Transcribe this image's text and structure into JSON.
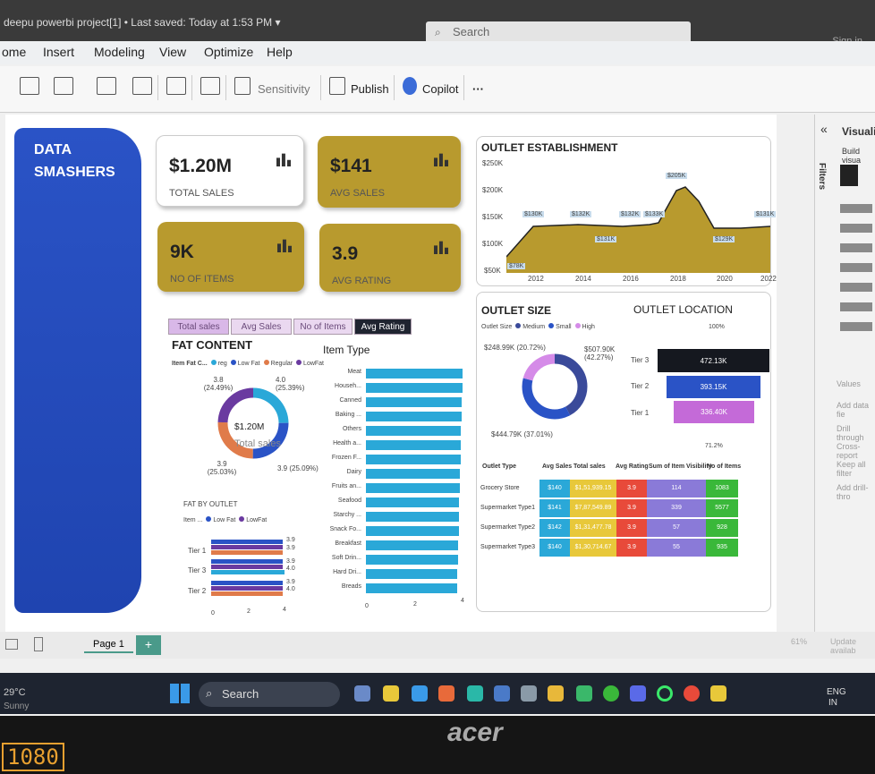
{
  "window": {
    "title": "deepu powerbi project[1] • Last saved: Today at 1:53 PM ▾",
    "search": "Search",
    "signin": "Sign in"
  },
  "menu": [
    "ome",
    "Insert",
    "Modeling",
    "View",
    "Optimize",
    "Help"
  ],
  "ribbon": {
    "sensitivity": "Sensitivity",
    "publish": "Publish",
    "copilot": "Copilot",
    "more": "···"
  },
  "sidebar": {
    "title": "DATA SMASHERS"
  },
  "kpis": [
    {
      "value": "$1.20M",
      "label": "TOTAL SALES"
    },
    {
      "value": "$141",
      "label": "AVG SALES"
    },
    {
      "value": "9K",
      "label": "NO OF ITEMS"
    },
    {
      "value": "3.9",
      "label": "AVG RATING"
    }
  ],
  "tabs": [
    "Total sales",
    "Avg Sales",
    "No of Items",
    "Avg Rating"
  ],
  "fat_content": {
    "title": "FAT CONTENT",
    "legend_title": "Item Fat C...",
    "legend": [
      "reg",
      "Low Fat",
      "Regular",
      "LowFat"
    ],
    "center_value": "$1.20M",
    "center_label": "Total sales",
    "labels": [
      "3.8\n(24.49%)",
      "4.0\n(25.39%)",
      "3.9\n(25.03%)",
      "3.9 (25.09%)"
    ]
  },
  "fat_by_outlet": {
    "title": "FAT BY OUTLET",
    "legend_title": "Item ...",
    "legend": [
      "Low Fat",
      "LowFat"
    ],
    "tiers": [
      "Tier 1",
      "Tier 3",
      "Tier 2"
    ],
    "values": [
      "3.9",
      "3.9",
      "3.9",
      "4.0",
      "3.9",
      "4.0"
    ],
    "axis": [
      "0",
      "2",
      "4"
    ]
  },
  "item_type": {
    "title": "Item Type",
    "labels": [
      "Meat",
      "Househ...",
      "Canned",
      "Baking ...",
      "Others",
      "Health a...",
      "Frozen F...",
      "Dairy",
      "Fruits an...",
      "Seafood",
      "Starchy ...",
      "Snack Fo...",
      "Breakfast",
      "Soft Drin...",
      "Hard Dri...",
      "Breads"
    ],
    "axis": [
      "0",
      "2",
      "4"
    ]
  },
  "outlet_establishment": {
    "title": "OUTLET ESTABLISHMENT",
    "y_ticks": [
      "$250K",
      "$200K",
      "$150K",
      "$100K",
      "$50K"
    ],
    "x_ticks": [
      "2012",
      "2014",
      "2016",
      "2018",
      "2020",
      "2022"
    ],
    "point_labels": [
      "$78K",
      "$130K",
      "$132K",
      "$131K",
      "$132K",
      "$133K",
      "$205K",
      "$129K",
      "$131K"
    ]
  },
  "outlet_size": {
    "title": "OUTLET SIZE",
    "legend_title": "Outlet Size",
    "legend": [
      "Medium",
      "Small",
      "High"
    ],
    "labels": [
      "$248.99K (20.72%)",
      "$507.90K\n(42.27%)",
      "$444.79K (37.01%)"
    ]
  },
  "outlet_location": {
    "title": "OUTLET LOCATION",
    "top_label": "100%",
    "bottom_label": "71.2%",
    "tiers": [
      "Tier 3",
      "Tier 2",
      "Tier 1"
    ],
    "values": [
      "472.13K",
      "393.15K",
      "336.40K"
    ]
  },
  "outlet_table": {
    "headers": [
      "Outlet Type",
      "Avg Sales",
      "Total sales",
      "Avg Rating",
      "Sum of Item Visibility",
      "No of Items"
    ],
    "rows": [
      [
        "Grocery Store",
        "$140",
        "$1,51,939.15",
        "3.9",
        "114",
        "1083"
      ],
      [
        "Supermarket Type1",
        "$141",
        "$7,87,549.89",
        "3.9",
        "339",
        "5577"
      ],
      [
        "Supermarket Type2",
        "$142",
        "$1,31,477.78",
        "3.9",
        "57",
        "928"
      ],
      [
        "Supermarket Type3",
        "$140",
        "$1,30,714.67",
        "3.9",
        "55",
        "935"
      ]
    ]
  },
  "right_panel": {
    "title": "Visualiz",
    "sub": "Build visua",
    "filters": "Filters",
    "values": "Values",
    "add_data": "Add data fie",
    "drill": "Drill through",
    "cross": "Cross-report",
    "keep": "Keep all filter",
    "add_drill": "Add drill-thro"
  },
  "status": {
    "page": "Page 1",
    "add": "+",
    "zoom": "61%",
    "update": "Update availab"
  },
  "taskbar": {
    "search": "Search",
    "weather_temp": "29°C",
    "weather": "Sunny",
    "lang": "ENG",
    "lang2": "IN"
  },
  "bezel": {
    "brand": "acer",
    "badge": "1080"
  }
}
